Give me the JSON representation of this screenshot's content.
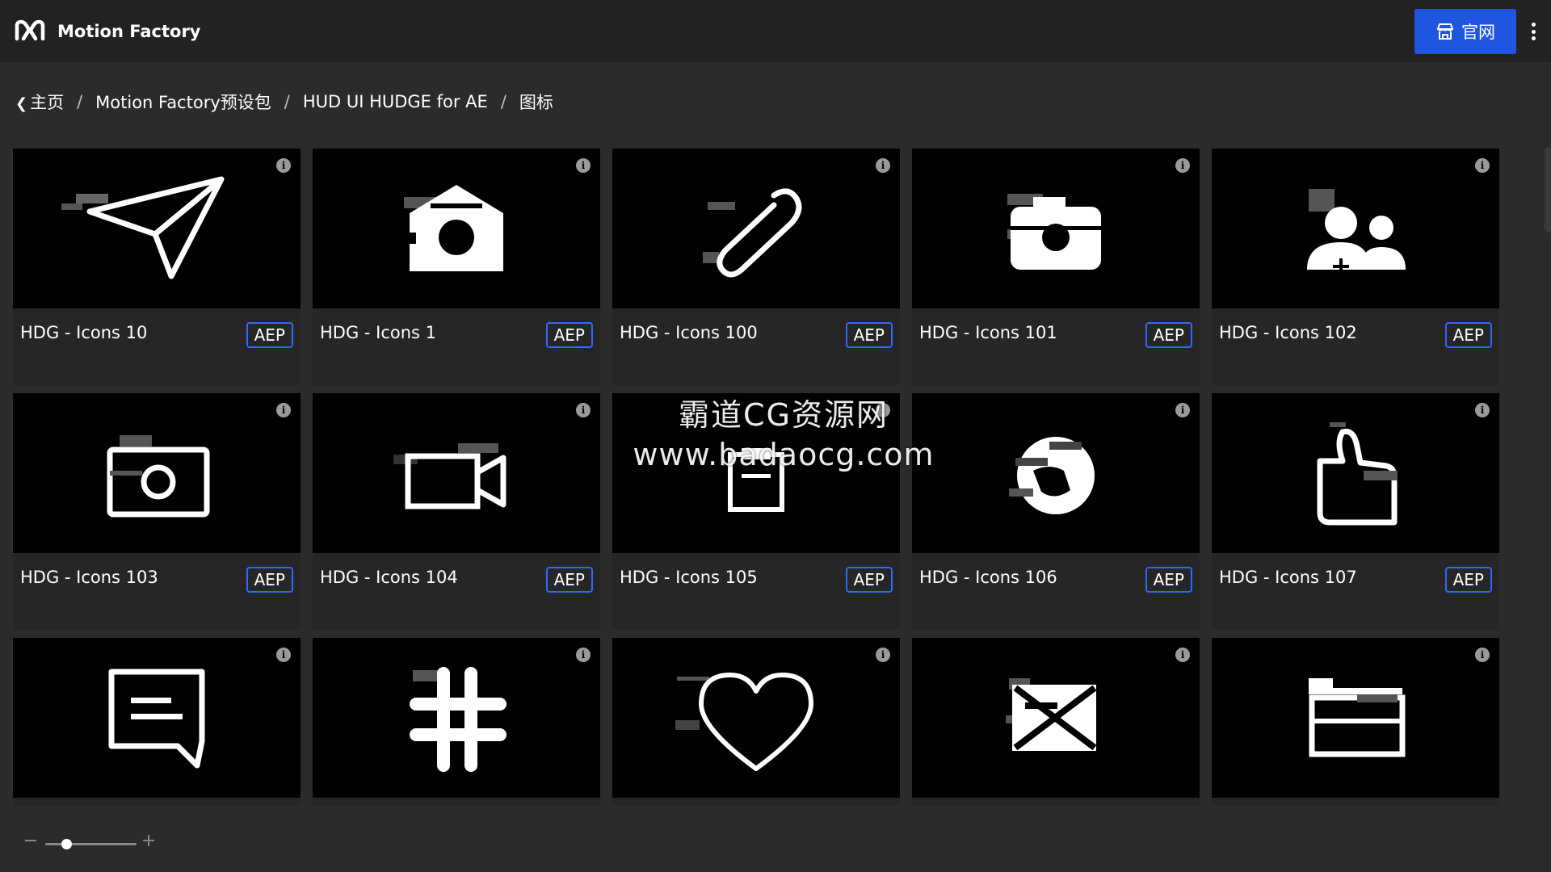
{
  "app": {
    "title": "Motion Factory",
    "logo_icon": "motion-factory-logo-icon"
  },
  "header": {
    "site_button_label": "官网",
    "site_button_icon": "storefront-icon",
    "site_button_color": "#1f56e0",
    "more_icon": "more-vertical-icon"
  },
  "breadcrumb": {
    "back_icon": "chevron-left-icon",
    "items": [
      "主页",
      "Motion Factory预设包",
      "HUD UI HUDGE for AE",
      "图标"
    ],
    "separator": "/"
  },
  "cards": [
    {
      "title": "HDG - Icons 10",
      "badge": "AEP",
      "icon": "send-paper-plane-icon"
    },
    {
      "title": "HDG - Icons 1",
      "badge": "AEP",
      "icon": "home-icon"
    },
    {
      "title": "HDG - Icons 100",
      "badge": "AEP",
      "icon": "paperclip-icon"
    },
    {
      "title": "HDG - Icons 101",
      "badge": "AEP",
      "icon": "camera-icon"
    },
    {
      "title": "HDG - Icons 102",
      "badge": "AEP",
      "icon": "add-user-icon"
    },
    {
      "title": "HDG - Icons 103",
      "badge": "AEP",
      "icon": "camera-outline-icon"
    },
    {
      "title": "HDG - Icons 104",
      "badge": "AEP",
      "icon": "video-camera-icon"
    },
    {
      "title": "HDG - Icons 105",
      "badge": "AEP",
      "icon": "clipboard-icon"
    },
    {
      "title": "HDG - Icons 106",
      "badge": "AEP",
      "icon": "globe-icon"
    },
    {
      "title": "HDG - Icons 107",
      "badge": "AEP",
      "icon": "thumbs-up-icon"
    },
    {
      "title": "",
      "badge": "",
      "icon": "chat-bubble-icon"
    },
    {
      "title": "",
      "badge": "",
      "icon": "hashtag-icon"
    },
    {
      "title": "",
      "badge": "",
      "icon": "heart-icon"
    },
    {
      "title": "",
      "badge": "",
      "icon": "mail-icon"
    },
    {
      "title": "",
      "badge": "",
      "icon": "folder-icon"
    }
  ],
  "info_glyph": "i",
  "badge_border_color": "#2f69ff",
  "zoom": {
    "minus_icon": "zoom-out-icon",
    "plus_icon": "zoom-in-icon",
    "level": 0.2
  },
  "watermark": {
    "line1": "霸道CG资源网",
    "line2": "www.badaocg.com"
  }
}
